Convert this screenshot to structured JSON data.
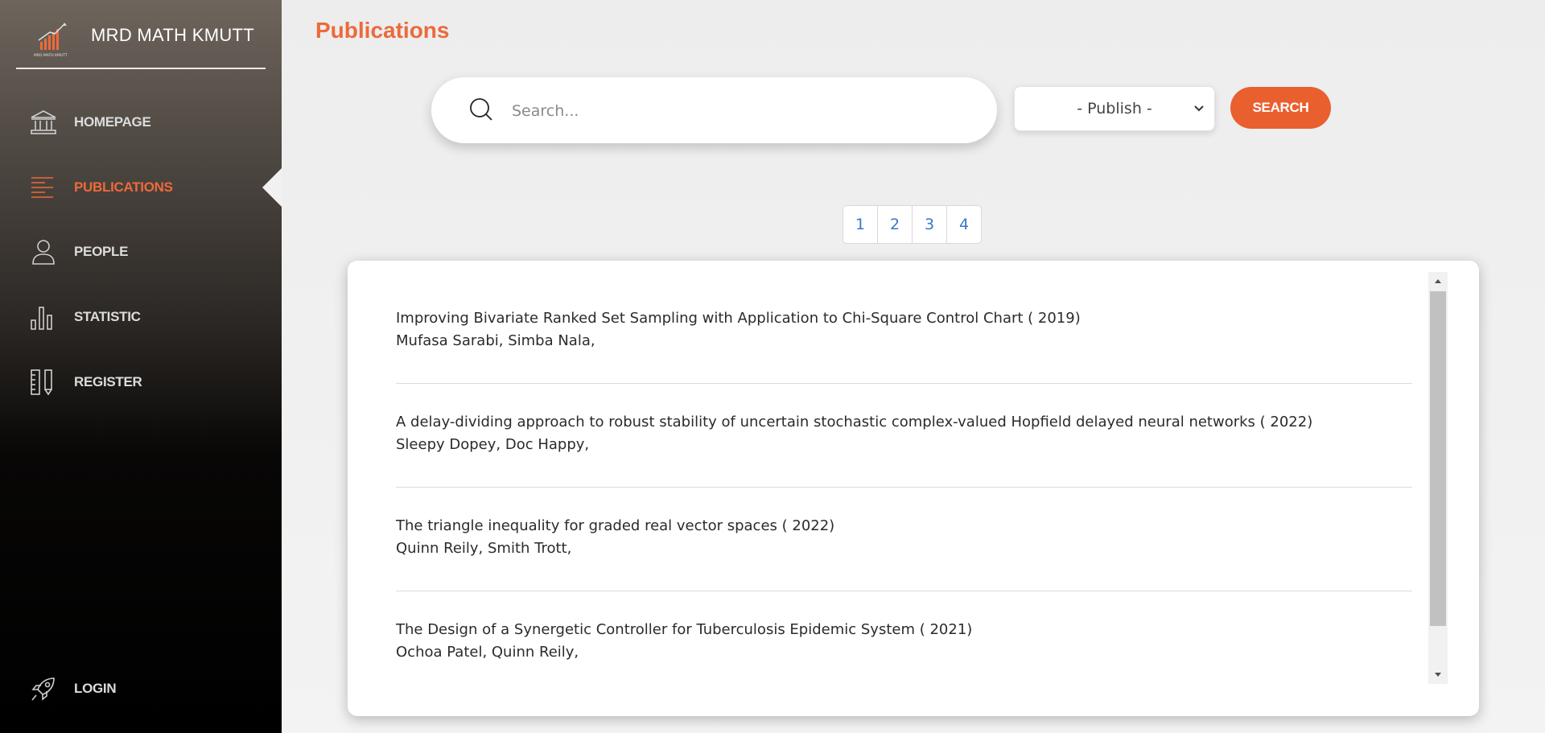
{
  "brand": {
    "name": "MRD MATH KMUTT",
    "logo_text": "MRD MATH KMUTT",
    "logo_icon": "bar-chart-logo-icon"
  },
  "sidebar": {
    "items": [
      {
        "label": "HOMEPAGE",
        "icon": "bank-icon",
        "active": false
      },
      {
        "label": "PUBLICATIONS",
        "icon": "lines-icon",
        "active": true
      },
      {
        "label": "PEOPLE",
        "icon": "person-icon",
        "active": false
      },
      {
        "label": "STATISTIC",
        "icon": "bar-chart-icon",
        "active": false
      },
      {
        "label": "REGISTER",
        "icon": "ruler-pencil-icon",
        "active": false
      }
    ],
    "login": {
      "label": "LOGIN",
      "icon": "rocket-icon"
    }
  },
  "header": {
    "title": "Publications"
  },
  "search": {
    "placeholder": "Search..."
  },
  "publish_filter": {
    "selected": "- Publish -"
  },
  "search_button": {
    "label": "SEARCH"
  },
  "pagination": {
    "pages": [
      "1",
      "2",
      "3",
      "4"
    ]
  },
  "publications": [
    {
      "title": "Improving Bivariate Ranked Set Sampling with Application to Chi-Square Control Chart ( 2019)",
      "authors": "Mufasa Sarabi, Simba Nala,"
    },
    {
      "title": "A delay-dividing approach to robust stability of uncertain stochastic complex-valued Hopfield delayed neural networks ( 2022)",
      "authors": "Sleepy Dopey, Doc Happy,"
    },
    {
      "title": "The triangle inequality for graded real vector spaces ( 2022)",
      "authors": "Quinn Reily, Smith Trott,"
    },
    {
      "title": "The Design of a Synergetic Controller for Tuberculosis Epidemic System ( 2021)",
      "authors": "Ochoa Patel, Quinn Reily,"
    }
  ],
  "colors": {
    "accent": "#ea5f2e",
    "title": "#ec6a3c",
    "link": "#3a78c9",
    "sidebar_text": "#dcdcdc"
  }
}
